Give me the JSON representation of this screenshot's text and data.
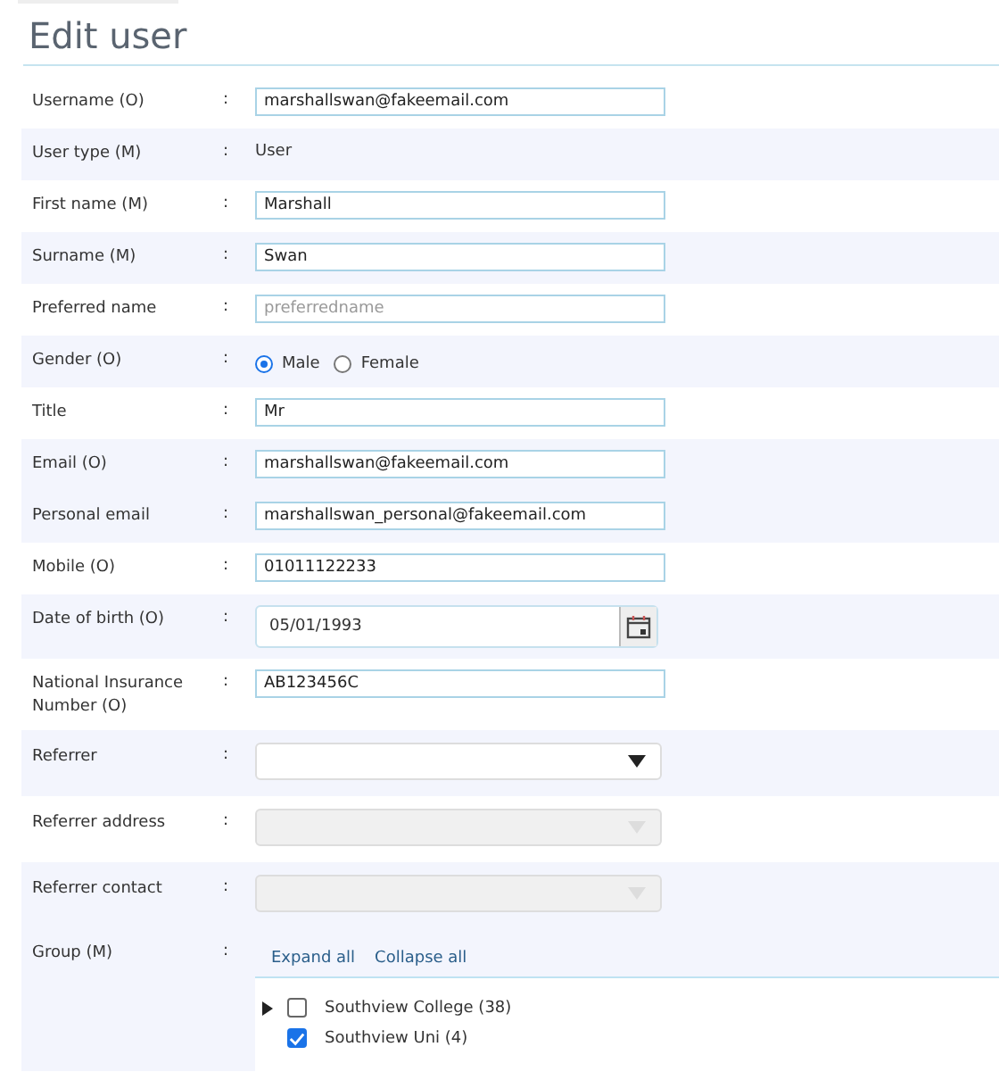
{
  "title": "Edit user",
  "bands": [
    [
      {
        "label": "Username  (O)",
        "colon": ":",
        "kind": "text",
        "value": "marshallswan@fakeemail.com"
      }
    ],
    [
      {
        "label": "User type (M)",
        "colon": ":",
        "kind": "static",
        "value": "User"
      }
    ],
    [
      {
        "label": "First name (M)",
        "colon": ":",
        "kind": "text",
        "value": "Marshall"
      }
    ],
    [
      {
        "label": "Surname (M)",
        "colon": ":",
        "kind": "text",
        "value": "Swan"
      }
    ],
    [
      {
        "label": "Preferred name",
        "colon": ":",
        "kind": "text",
        "placeholder": "preferredname"
      }
    ],
    [
      {
        "label": "Gender (O)",
        "colon": ":",
        "kind": "radio",
        "options": [
          {
            "label": "Male",
            "selected": true
          },
          {
            "label": "Female",
            "selected": false
          }
        ]
      }
    ],
    [
      {
        "label": "Title",
        "colon": ":",
        "kind": "text",
        "value": "Mr"
      }
    ],
    [
      {
        "label": "Email  (O)",
        "colon": ":",
        "kind": "text",
        "value": "marshallswan@fakeemail.com"
      },
      {
        "label": "Personal email",
        "colon": ":",
        "kind": "text",
        "value": "marshallswan_personal@fakeemail.com"
      }
    ],
    [
      {
        "label": "Mobile  (O)",
        "colon": ":",
        "kind": "text",
        "value": "01011122233"
      }
    ],
    [
      {
        "label": "Date of birth (O)",
        "colon": ":",
        "kind": "date",
        "value": "05/01/1993"
      }
    ],
    [
      {
        "label": "National Insurance Number (O)",
        "colon": ":",
        "kind": "text",
        "value": "AB123456C"
      }
    ],
    [
      {
        "label": "Referrer",
        "colon": ":",
        "kind": "select",
        "disabled": false
      }
    ],
    [
      {
        "label": "Referrer address",
        "colon": ":",
        "kind": "select",
        "disabled": true
      }
    ],
    [
      {
        "label": "Referrer contact",
        "colon": ":",
        "kind": "select",
        "disabled": true
      },
      {
        "label": "Group (M)",
        "colon": ":",
        "kind": "tree",
        "links": [
          "Expand all",
          "Collapse all"
        ],
        "items": [
          {
            "label": "Southview College (38)",
            "checked": false,
            "has_children": true
          },
          {
            "label": "Southview Uni (4)",
            "checked": true,
            "has_children": false
          }
        ]
      }
    ]
  ]
}
